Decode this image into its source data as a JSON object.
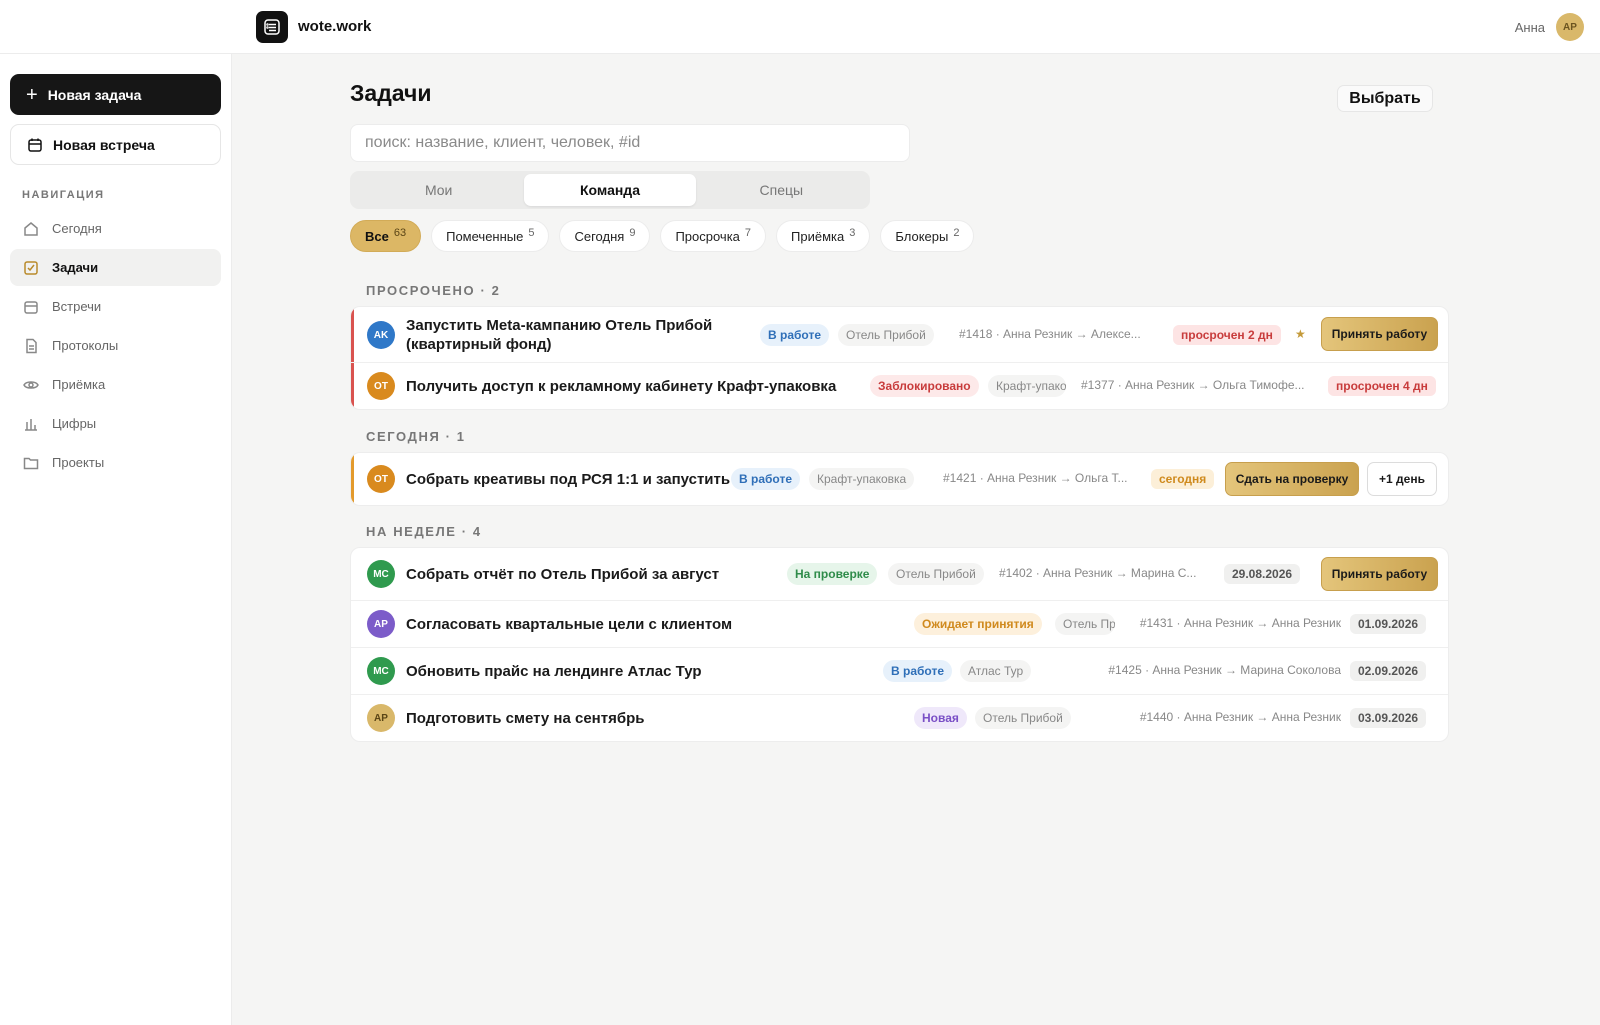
{
  "app": {
    "name": "wote.work"
  },
  "user": {
    "name": "Анна",
    "initials": "AP"
  },
  "sidebar": {
    "new_task": "Новая задача",
    "new_meeting": "Новая встреча",
    "nav_title": "НАВИГАЦИЯ",
    "items": [
      {
        "label": "Сегодня",
        "icon": "home-icon"
      },
      {
        "label": "Задачи",
        "icon": "checkbox-icon",
        "active": true
      },
      {
        "label": "Встречи",
        "icon": "calendar-icon"
      },
      {
        "label": "Протоколы",
        "icon": "document-icon"
      },
      {
        "label": "Приёмка",
        "icon": "eye-icon"
      },
      {
        "label": "Цифры",
        "icon": "bar-chart-icon"
      },
      {
        "label": "Проекты",
        "icon": "folder-icon"
      }
    ]
  },
  "main": {
    "title": "Задачи",
    "select_button": "Выбрать",
    "search_placeholder": "поиск: название, клиент, человек, #id",
    "tabs": [
      {
        "label": "Мои"
      },
      {
        "label": "Команда",
        "active": true
      },
      {
        "label": "Спецы"
      }
    ],
    "filters": [
      {
        "label": "Все",
        "count": "63",
        "active": true
      },
      {
        "label": "Помеченные",
        "count": "5"
      },
      {
        "label": "Сегодня",
        "count": "9"
      },
      {
        "label": "Просрочка",
        "count": "7"
      },
      {
        "label": "Приёмка",
        "count": "3"
      },
      {
        "label": "Блокеры",
        "count": "2"
      }
    ]
  },
  "groups": {
    "overdue": {
      "label": "ПРОСРОЧЕНО · 2",
      "rows": [
        {
          "initials": "AK",
          "title_line1": "Запустить Meta-кампанию Отель Прибой",
          "title_line2": "(квартирный фонд)",
          "status": "В работе",
          "client": "Отель Прибой",
          "meta": "#1418 · Анна Резник → Алексе...",
          "badge": "просрочен 2 дн",
          "action": "Принять работу"
        },
        {
          "initials": "OT",
          "title": "Получить доступ к рекламному кабинету Крафт-упаковка",
          "status": "Заблокировано",
          "client": "Крафт-упаковка",
          "meta": "#1377 · Анна Резник → Ольга Тимофе...",
          "badge": "просрочен 4 дн"
        }
      ]
    },
    "today": {
      "label": "СЕГОДНЯ · 1",
      "rows": [
        {
          "initials": "OT",
          "title": "Собрать креативы под РСЯ 1:1 и запустить",
          "status": "В работе",
          "client": "Крафт-упаковка",
          "meta": "#1421 · Анна Резник → Ольга Т...",
          "badge": "сегодня",
          "action": "Сдать на проверку",
          "action2": "+1 день"
        }
      ]
    },
    "week": {
      "label": "НА НЕДЕЛЕ · 4",
      "rows": [
        {
          "initials": "MC",
          "title": "Собрать отчёт по Отель Прибой за август",
          "status": "На проверке",
          "client": "Отель Прибой",
          "meta": "#1402 · Анна Резник → Марина С...",
          "badge": "29.08.2026",
          "action": "Принять работу"
        },
        {
          "initials": "AP",
          "title": "Согласовать квартальные цели с клиентом",
          "status": "Ожидает принятия",
          "client": "Отель Прибой",
          "meta": "#1431 · Анна Резник → Анна Резник",
          "badge": "01.09.2026"
        },
        {
          "initials": "MC",
          "title": "Обновить прайс на лендинге Атлас Тур",
          "status": "В работе",
          "client": "Атлас Тур",
          "meta": "#1425 · Анна Резник → Марина Соколова",
          "badge": "02.09.2026"
        },
        {
          "initials": "AP",
          "title": "Подготовить смету на сентябрь",
          "status": "Новая",
          "client": "Отель Прибой",
          "meta": "#1440 · Анна Резник → Анна Резник",
          "badge": "03.09.2026"
        }
      ]
    }
  },
  "colors": {
    "accent_gold": "#d9b86a",
    "overdue_red": "#d9534f",
    "today_orange": "#e39a2c",
    "avatar_blue": "#2f78c8",
    "avatar_orange": "#d98a1e",
    "avatar_green": "#2f9a4e",
    "avatar_purple": "#7c5cc9",
    "avatar_gold": "#d9b86a"
  }
}
